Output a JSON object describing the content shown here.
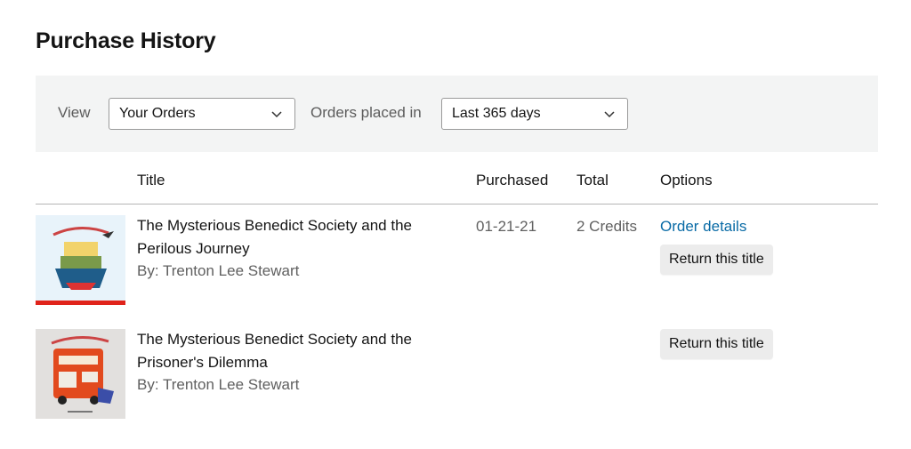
{
  "page": {
    "title": "Purchase History"
  },
  "filters": {
    "view_label": "View",
    "view_value": "Your Orders",
    "orders_placed_label": "Orders placed in",
    "orders_placed_value": "Last 365 days"
  },
  "table": {
    "columns": [
      "Title",
      "Purchased",
      "Total",
      "Options"
    ],
    "rows": [
      {
        "title": "The Mysterious Benedict Society and the Perilous Journey",
        "author": "By: Trenton Lee Stewart",
        "purchased": "01-21-21",
        "total": "2 Credits",
        "order_details_label": "Order details",
        "return_label": "Return this title",
        "cover_bg": "#e8f3fa",
        "cover_accent": "#e0231b"
      },
      {
        "title": "The Mysterious Benedict Society and the Prisoner's Dilemma",
        "author": "By: Trenton Lee Stewart",
        "purchased": "",
        "total": "",
        "return_label": "Return this title",
        "cover_bg": "#e2e0de",
        "cover_accent": "#e24a1e"
      }
    ]
  },
  "colors": {
    "link": "#0a6ba6",
    "filter_bg": "#f3f4f4",
    "button_bg": "#ececec"
  }
}
